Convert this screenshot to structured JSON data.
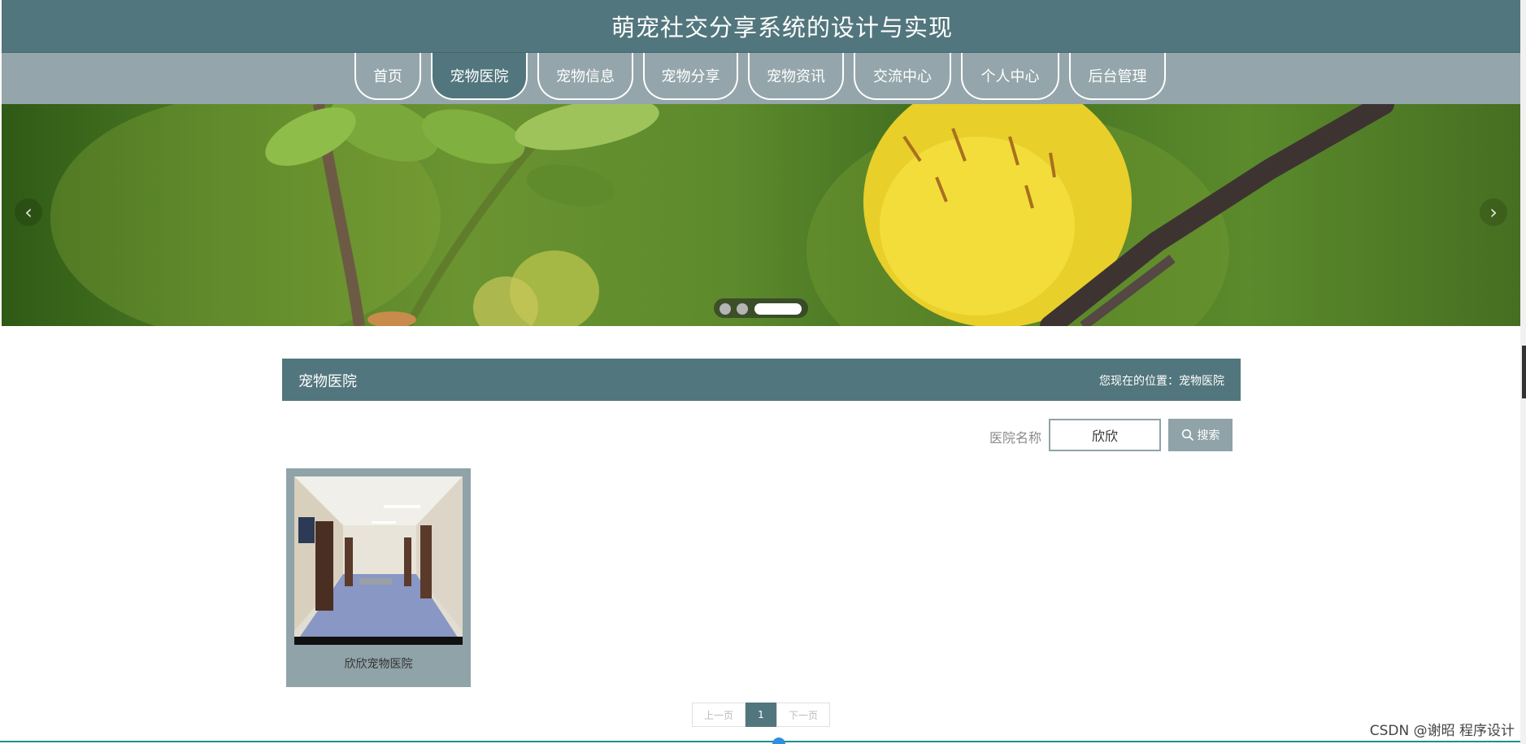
{
  "header": {
    "title": "萌宠社交分享系统的设计与实现"
  },
  "nav": {
    "items": [
      {
        "label": "首页",
        "active": false
      },
      {
        "label": "宠物医院",
        "active": true
      },
      {
        "label": "宠物信息",
        "active": false
      },
      {
        "label": "宠物分享",
        "active": false
      },
      {
        "label": "宠物资讯",
        "active": false
      },
      {
        "label": "交流中心",
        "active": false
      },
      {
        "label": "个人中心",
        "active": false
      },
      {
        "label": "后台管理",
        "active": false
      }
    ]
  },
  "carousel": {
    "prev_icon": "‹",
    "next_icon": "›",
    "slide_count": 3,
    "active_index": 2
  },
  "section": {
    "title": "宠物医院",
    "breadcrumb": "您现在的位置：宠物医院"
  },
  "search": {
    "label": "医院名称",
    "value": "欣欣",
    "button_label": "搜索",
    "button_icon": "search-icon"
  },
  "cards": [
    {
      "title": "欣欣宠物医院"
    }
  ],
  "pagination": {
    "prev_label": "上一页",
    "current_page": "1",
    "next_label": "下一页"
  },
  "watermark": "CSDN @谢昭  程序设计",
  "colors": {
    "primary": "#52767d",
    "nav_bg": "#94a6ab",
    "card_bg": "#8fa3a8"
  }
}
